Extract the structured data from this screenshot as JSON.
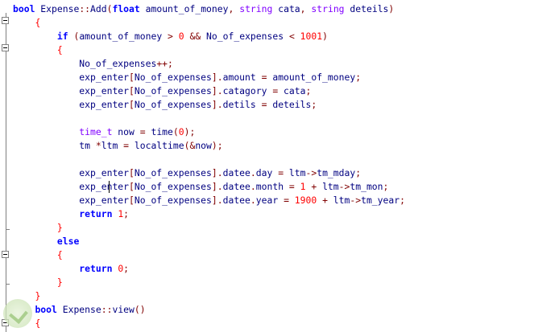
{
  "editor": {
    "lines": [
      [
        [
          "k",
          "bool"
        ],
        [
          "t",
          " Expense"
        ],
        [
          "p",
          "::"
        ],
        [
          "t",
          "Add"
        ],
        [
          "p",
          "("
        ],
        [
          "k",
          "float"
        ],
        [
          "t",
          " amount_of_money"
        ],
        [
          "p",
          ","
        ],
        [
          "t",
          " "
        ],
        [
          "ty",
          "string"
        ],
        [
          "t",
          " cata"
        ],
        [
          "p",
          ","
        ],
        [
          "t",
          " "
        ],
        [
          "ty",
          "string"
        ],
        [
          "t",
          " deteils"
        ],
        [
          "p",
          ")"
        ]
      ],
      [
        [
          "t",
          "    "
        ],
        [
          "br",
          "{"
        ]
      ],
      [
        [
          "t",
          "        "
        ],
        [
          "k",
          "if"
        ],
        [
          "t",
          " "
        ],
        [
          "p",
          "("
        ],
        [
          "t",
          "amount_of_money "
        ],
        [
          "p",
          ">"
        ],
        [
          "t",
          " "
        ],
        [
          "num",
          "0"
        ],
        [
          "t",
          " "
        ],
        [
          "p",
          "&&"
        ],
        [
          "t",
          " No_of_expenses "
        ],
        [
          "p",
          "<"
        ],
        [
          "t",
          " "
        ],
        [
          "num",
          "1001"
        ],
        [
          "p",
          ")"
        ]
      ],
      [
        [
          "t",
          "        "
        ],
        [
          "br",
          "{"
        ]
      ],
      [
        [
          "t",
          "            No_of_expenses"
        ],
        [
          "p",
          "++;"
        ]
      ],
      [
        [
          "t",
          "            exp_enter"
        ],
        [
          "p",
          "["
        ],
        [
          "t",
          "No_of_expenses"
        ],
        [
          "p",
          "]."
        ],
        [
          "t",
          "amount "
        ],
        [
          "p",
          "="
        ],
        [
          "t",
          " amount_of_money"
        ],
        [
          "p",
          ";"
        ]
      ],
      [
        [
          "t",
          "            exp_enter"
        ],
        [
          "p",
          "["
        ],
        [
          "t",
          "No_of_expenses"
        ],
        [
          "p",
          "]."
        ],
        [
          "t",
          "catagory "
        ],
        [
          "p",
          "="
        ],
        [
          "t",
          " cata"
        ],
        [
          "p",
          ";"
        ]
      ],
      [
        [
          "t",
          "            exp_enter"
        ],
        [
          "p",
          "["
        ],
        [
          "t",
          "No_of_expenses"
        ],
        [
          "p",
          "]."
        ],
        [
          "t",
          "detils "
        ],
        [
          "p",
          "="
        ],
        [
          "t",
          " deteils"
        ],
        [
          "p",
          ";"
        ]
      ],
      [],
      [
        [
          "t",
          "            "
        ],
        [
          "kt",
          "time_t"
        ],
        [
          "t",
          " now "
        ],
        [
          "p",
          "="
        ],
        [
          "t",
          " time"
        ],
        [
          "p",
          "("
        ],
        [
          "num",
          "0"
        ],
        [
          "p",
          ");"
        ]
      ],
      [
        [
          "t",
          "            tm "
        ],
        [
          "p",
          "*"
        ],
        [
          "t",
          "ltm "
        ],
        [
          "p",
          "="
        ],
        [
          "t",
          " localtime"
        ],
        [
          "p",
          "(&"
        ],
        [
          "t",
          "now"
        ],
        [
          "p",
          ");"
        ]
      ],
      [],
      [
        [
          "t",
          "            exp_enter"
        ],
        [
          "p",
          "["
        ],
        [
          "t",
          "No_of_expenses"
        ],
        [
          "p",
          "]."
        ],
        [
          "t",
          "datee"
        ],
        [
          "p",
          "."
        ],
        [
          "t",
          "day "
        ],
        [
          "p",
          "="
        ],
        [
          "t",
          " ltm"
        ],
        [
          "p",
          "->"
        ],
        [
          "t",
          "tm_mday"
        ],
        [
          "p",
          ";"
        ]
      ],
      [
        [
          "t",
          "            exp_enter"
        ],
        [
          "p",
          "["
        ],
        [
          "t",
          "No_of_expenses"
        ],
        [
          "p",
          "]."
        ],
        [
          "t",
          "datee"
        ],
        [
          "p",
          "."
        ],
        [
          "t",
          "month "
        ],
        [
          "p",
          "="
        ],
        [
          "t",
          " "
        ],
        [
          "num",
          "1"
        ],
        [
          "t",
          " "
        ],
        [
          "p",
          "+"
        ],
        [
          "t",
          " ltm"
        ],
        [
          "p",
          "->"
        ],
        [
          "t",
          "tm_mon"
        ],
        [
          "p",
          ";"
        ]
      ],
      [
        [
          "t",
          "            exp_enter"
        ],
        [
          "p",
          "["
        ],
        [
          "t",
          "No_of_expenses"
        ],
        [
          "p",
          "]."
        ],
        [
          "t",
          "datee"
        ],
        [
          "p",
          "."
        ],
        [
          "t",
          "year "
        ],
        [
          "p",
          "="
        ],
        [
          "t",
          " "
        ],
        [
          "num",
          "1900"
        ],
        [
          "t",
          " "
        ],
        [
          "p",
          "+"
        ],
        [
          "t",
          " ltm"
        ],
        [
          "p",
          "->"
        ],
        [
          "t",
          "tm_year"
        ],
        [
          "p",
          ";"
        ]
      ],
      [
        [
          "t",
          "            "
        ],
        [
          "k",
          "return"
        ],
        [
          "t",
          " "
        ],
        [
          "num",
          "1"
        ],
        [
          "p",
          ";"
        ]
      ],
      [
        [
          "t",
          "        "
        ],
        [
          "br",
          "}"
        ]
      ],
      [
        [
          "t",
          "        "
        ],
        [
          "k",
          "else"
        ]
      ],
      [
        [
          "t",
          "        "
        ],
        [
          "br",
          "{"
        ]
      ],
      [
        [
          "t",
          "            "
        ],
        [
          "k",
          "return"
        ],
        [
          "t",
          " "
        ],
        [
          "num",
          "0"
        ],
        [
          "p",
          ";"
        ]
      ],
      [
        [
          "t",
          "        "
        ],
        [
          "br",
          "}"
        ]
      ],
      [
        [
          "t",
          "    "
        ],
        [
          "br",
          "}"
        ]
      ],
      [
        [
          "t",
          "    "
        ],
        [
          "k",
          "bool"
        ],
        [
          "t",
          " Expense"
        ],
        [
          "p",
          "::"
        ],
        [
          "t",
          "view"
        ],
        [
          "p",
          "()"
        ]
      ],
      [
        [
          "t",
          "    "
        ],
        [
          "br",
          "{"
        ]
      ]
    ]
  }
}
